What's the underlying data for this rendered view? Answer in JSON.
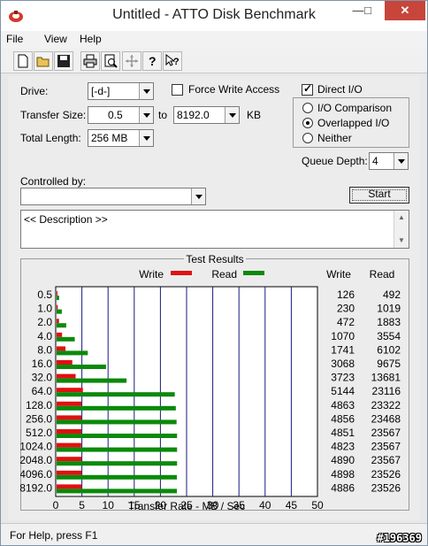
{
  "window": {
    "title": "Untitled - ATTO Disk Benchmark"
  },
  "menubar": {
    "items": [
      "File",
      "View",
      "Help"
    ]
  },
  "controls": {
    "drive_label": "Drive:",
    "drive_value": "[-d-]",
    "force_write_access_label": "Force Write Access",
    "direct_io_label": "Direct I/O",
    "transfer_size_label": "Transfer Size:",
    "transfer_from": "0.5",
    "to_label": "to",
    "transfer_to": "8192.0",
    "kb_label": "KB",
    "total_length_label": "Total Length:",
    "total_length_value": "256 MB",
    "io_comparison_label": "I/O Comparison",
    "overlapped_io_label": "Overlapped I/O",
    "neither_label": "Neither",
    "queue_depth_label": "Queue Depth:",
    "queue_depth_value": "4",
    "controlled_by_label": "Controlled by:",
    "controlled_by_value": "",
    "start_label": "Start",
    "description_text": "<< Description >>"
  },
  "chart_data": {
    "type": "bar",
    "title": "Test Results",
    "xlabel": "Transfer Rate - MB / Sec",
    "xlim": [
      0,
      50
    ],
    "xticks": [
      "0",
      "5",
      "10",
      "15",
      "20",
      "25",
      "30",
      "35",
      "40",
      "45",
      "50"
    ],
    "legend": [
      {
        "name": "Write",
        "color": "#e01010"
      },
      {
        "name": "Read",
        "color": "#0a8a0a"
      }
    ],
    "col_headers": [
      "Write",
      "Read"
    ],
    "categories": [
      "0.5",
      "1.0",
      "2.0",
      "4.0",
      "8.0",
      "16.0",
      "32.0",
      "64.0",
      "128.0",
      "256.0",
      "512.0",
      "1024.0",
      "2048.0",
      "4096.0",
      "8192.0"
    ],
    "series": [
      {
        "name": "Write",
        "color": "#e01010",
        "values": [
          126,
          230,
          472,
          1070,
          1741,
          3068,
          3723,
          5144,
          4863,
          4856,
          4851,
          4823,
          4890,
          4898,
          4886
        ]
      },
      {
        "name": "Read",
        "color": "#0a8a0a",
        "values": [
          492,
          1019,
          1883,
          3554,
          6102,
          9675,
          13681,
          23116,
          23322,
          23468,
          23567,
          23567,
          23567,
          23526,
          23526
        ]
      }
    ]
  },
  "statusbar": {
    "text": "For Help, press F1"
  },
  "watermark": "#196369"
}
